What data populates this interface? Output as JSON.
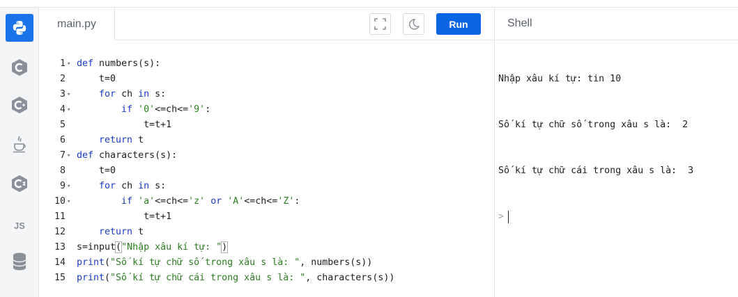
{
  "sidebar": {
    "items": [
      {
        "name": "python-icon",
        "active": true
      },
      {
        "name": "c-icon",
        "active": false
      },
      {
        "name": "cpp-icon",
        "active": false
      },
      {
        "name": "java-icon",
        "active": false
      },
      {
        "name": "csharp-icon",
        "active": false
      },
      {
        "name": "js-icon",
        "label": "JS",
        "active": false
      },
      {
        "name": "database-icon",
        "active": false
      }
    ]
  },
  "editor": {
    "file_tab": "main.py",
    "fullscreen_icon": "fullscreen-icon",
    "theme_icon": "moon-icon",
    "run_label": "Run",
    "run_color": "#0b65e3"
  },
  "code": {
    "lines": [
      {
        "n": "1",
        "fold": true
      },
      {
        "n": "2",
        "fold": false
      },
      {
        "n": "3",
        "fold": true
      },
      {
        "n": "4",
        "fold": true
      },
      {
        "n": "5",
        "fold": false
      },
      {
        "n": "6",
        "fold": false
      },
      {
        "n": "7",
        "fold": true
      },
      {
        "n": "8",
        "fold": false
      },
      {
        "n": "9",
        "fold": true
      },
      {
        "n": "10",
        "fold": true
      },
      {
        "n": "11",
        "fold": false
      },
      {
        "n": "12",
        "fold": false
      },
      {
        "n": "13",
        "fold": false
      },
      {
        "n": "14",
        "fold": false
      },
      {
        "n": "15",
        "fold": false
      }
    ],
    "tokens": {
      "l1": {
        "kw": "def",
        "rest": "numbers(s):"
      },
      "l2": {
        "text": "t=0"
      },
      "l3": {
        "kw1": "for",
        "mid": "ch",
        "kw2": "in",
        "rest": "s:"
      },
      "l4": {
        "kw": "if",
        "str1": "'0'",
        "mid": "<=ch<=",
        "str2": "'9'",
        "rest": ":"
      },
      "l5": {
        "text": "t=t+1"
      },
      "l6": {
        "kw": "return",
        "rest": "t"
      },
      "l7": {
        "kw": "def",
        "rest": "characters(s):"
      },
      "l8": {
        "text": "t=0"
      },
      "l9": {
        "kw1": "for",
        "mid": "ch",
        "kw2": "in",
        "rest": "s:"
      },
      "l10": {
        "kw": "if",
        "str1": "'a'",
        "mid1": "<=ch<=",
        "str2": "'z'",
        "kw2": "or",
        "str3": "'A'",
        "mid2": "<=ch<=",
        "str4": "'Z'",
        "rest": ":"
      },
      "l11": {
        "text": "t=t+1"
      },
      "l12": {
        "kw": "return",
        "rest": "t"
      },
      "l13": {
        "pre": "s=input",
        "open": "(",
        "str": "\"Nhập xâu kí tự: \"",
        "close": ")"
      },
      "l14": {
        "fn": "print",
        "open": "(",
        "str": "\"Số kí tự chữ số trong xâu s là: \"",
        "rest": ", numbers(s))"
      },
      "l15": {
        "fn": "print",
        "open": "(",
        "str": "\"Số kí tự chữ cái trong xâu s là: \"",
        "rest": ", characters(s))"
      }
    }
  },
  "shell": {
    "title": "Shell",
    "output": [
      "Nhập xâu kí tự: tin 10",
      "Số kí tự chữ số trong xâu s là:  2",
      "Số kí tự chữ cái trong xâu s là:  3"
    ],
    "prompt": ">"
  }
}
